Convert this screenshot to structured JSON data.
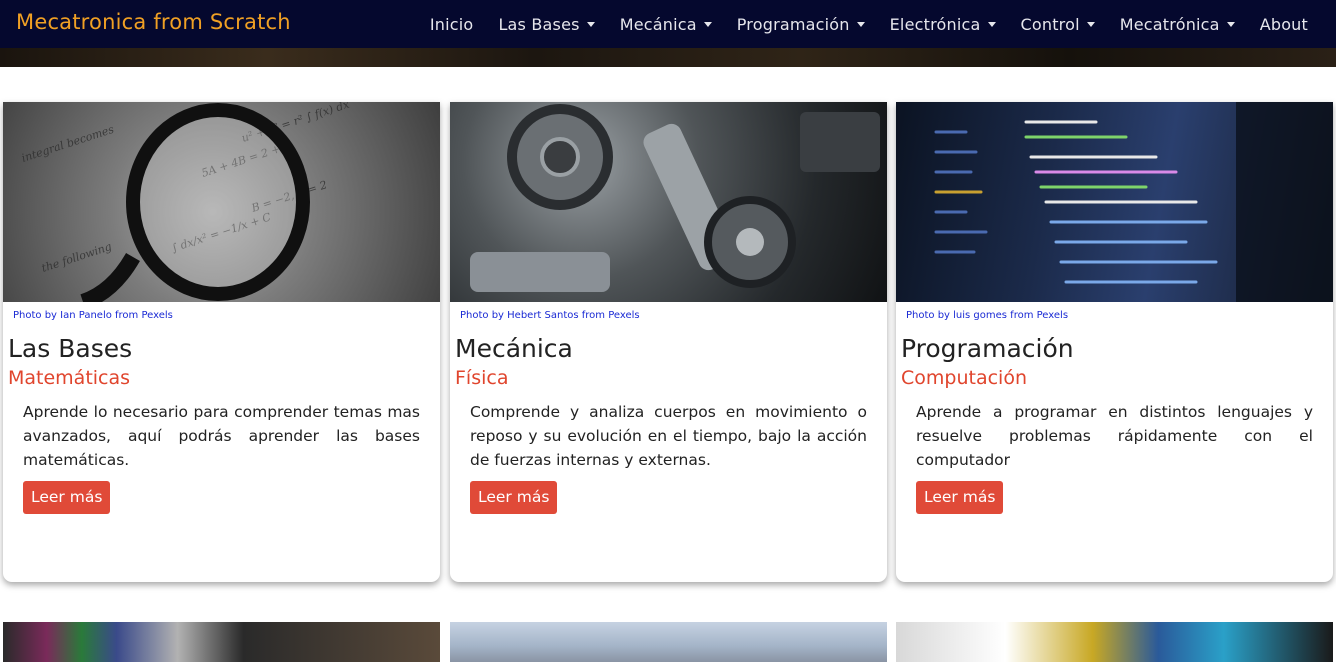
{
  "brand": "Mecatronica from Scratch",
  "nav": [
    {
      "label": "Inicio",
      "caret": false
    },
    {
      "label": "Las Bases",
      "caret": true
    },
    {
      "label": "Mecánica",
      "caret": true
    },
    {
      "label": "Programación",
      "caret": true
    },
    {
      "label": "Electrónica",
      "caret": true
    },
    {
      "label": "Control",
      "caret": true
    },
    {
      "label": "Mecatrónica",
      "caret": true
    },
    {
      "label": "About",
      "caret": false
    }
  ],
  "cards": [
    {
      "credit": "Photo by Ian Panelo from Pexels",
      "title": "Las Bases",
      "subtitle": "Matemáticas",
      "description": "Aprende lo necesario para comprender temas mas avanzados, aquí podrás aprender las bases matemáticas.",
      "button": "Leer más"
    },
    {
      "credit": "Photo by Hebert Santos from Pexels",
      "title": "Mecánica",
      "subtitle": "Física",
      "description": "Comprende y analiza cuerpos en movimiento o reposo y su evolución en el tiempo, bajo la acción de fuerzas internas y externas.",
      "button": "Leer más"
    },
    {
      "credit": "Photo by luis gomes from Pexels",
      "title": "Programación",
      "subtitle": "Computación",
      "description": "Aprende a programar en distintos lenguajes y resuelve problemas rápidamente con el computador",
      "button": "Leer más"
    }
  ],
  "colors": {
    "navbar": "#05082e",
    "brand": "#f0a024",
    "accent": "#e04a38",
    "credit_link": "#1a2ad4"
  },
  "icons": {
    "dropdown": "caret-down-icon"
  }
}
